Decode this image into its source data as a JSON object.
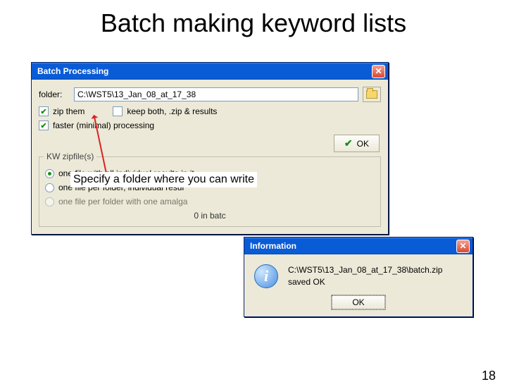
{
  "slide": {
    "title": "Batch making keyword lists",
    "annotation": "Specify a folder where you can write",
    "page_number": "18"
  },
  "batch_window": {
    "title": "Batch Processing",
    "folder_label": "folder:",
    "folder_value": "C:\\WST5\\13_Jan_08_at_17_38",
    "chk_zip": "zip them",
    "chk_keep": "keep both, .zip & results",
    "chk_fast": "faster (minimal) processing",
    "ok_label": "OK",
    "group_title": "KW zipfile(s)",
    "radio1": "one file with all individual results in it",
    "radio2": "one file per folder, individual resul",
    "radio3": "one file per folder with one amalga",
    "status": "0 in batc"
  },
  "info_window": {
    "title": "Information",
    "message_line1": "C:\\WST5\\13_Jan_08_at_17_38\\batch.zip",
    "message_line2": "saved OK",
    "ok_label": "OK"
  }
}
